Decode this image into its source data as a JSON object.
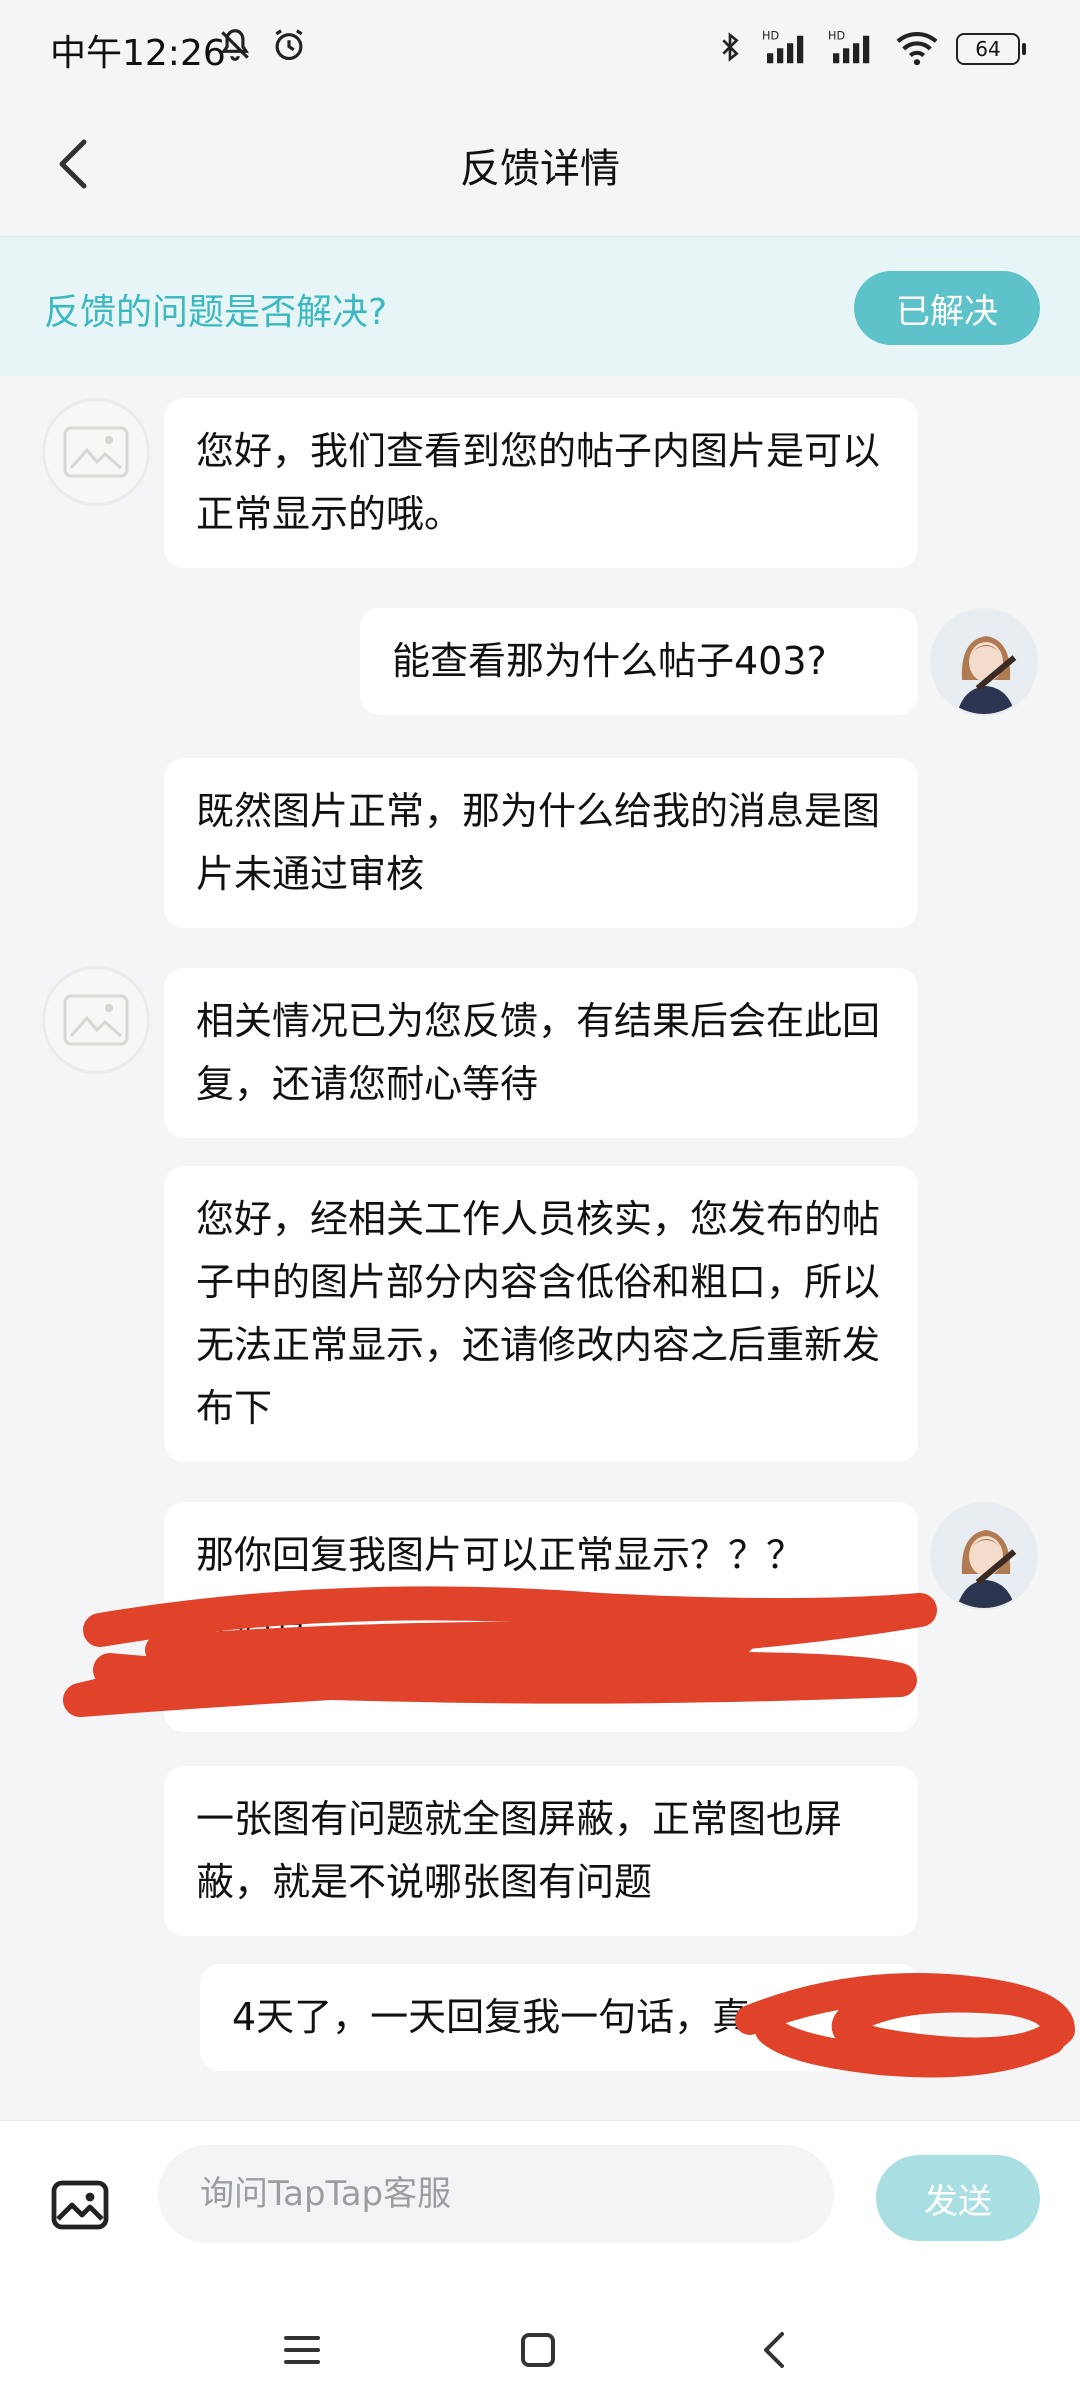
{
  "status_bar": {
    "time": "中午12:26",
    "battery": "64",
    "icons": [
      "mute-bell-icon",
      "alarm-icon",
      "bluetooth-icon",
      "signal-hd-icon",
      "signal-hd-icon",
      "wifi-icon",
      "battery-icon"
    ],
    "hd_label": "HD"
  },
  "header": {
    "title": "反馈详情",
    "back_icon": "chevron-left-icon"
  },
  "resolve_bar": {
    "question": "反馈的问题是否解决?",
    "button_label": "已解决",
    "accent_color": "#5dc2c9"
  },
  "messages": [
    {
      "side": "left",
      "text": "您好，我们查看到您的帖子内图片是可以正常显示的哦。"
    },
    {
      "side": "right",
      "text": "能查看那为什么帖子403?"
    },
    {
      "side": "left",
      "text": "既然图片正常，那为什么给我的消息是图片未通过审核"
    },
    {
      "side": "left",
      "text": "相关情况已为您反馈，有结果后会在此回复，还请您耐心等待"
    },
    {
      "side": "left",
      "text": "您好，经相关工作人员核实，您发布的帖子中的图片部分内容含低俗和粗口，所以无法正常显示，还请修改内容之后重新发布下"
    },
    {
      "side": "right",
      "text": "那你回复我图片可以正常显示？？？",
      "partial_visible": "你们客"
    },
    {
      "side": "left",
      "text": "一张图有问题就全图屏蔽，正常图也屏蔽，就是不说哪张图有问题"
    },
    {
      "side": "right",
      "text": "4天了，一天回复我一句话，真"
    }
  ],
  "input_bar": {
    "placeholder": "询问TapTap客服",
    "send_label": "发送",
    "image_icon": "image-icon"
  },
  "system_nav": {
    "icons": [
      "menu-icon",
      "home-square-icon",
      "back-chevron-icon"
    ]
  },
  "colors": {
    "accent": "#3cb8c1",
    "scribble": "#e0432a",
    "background": "#f3f5f7"
  }
}
